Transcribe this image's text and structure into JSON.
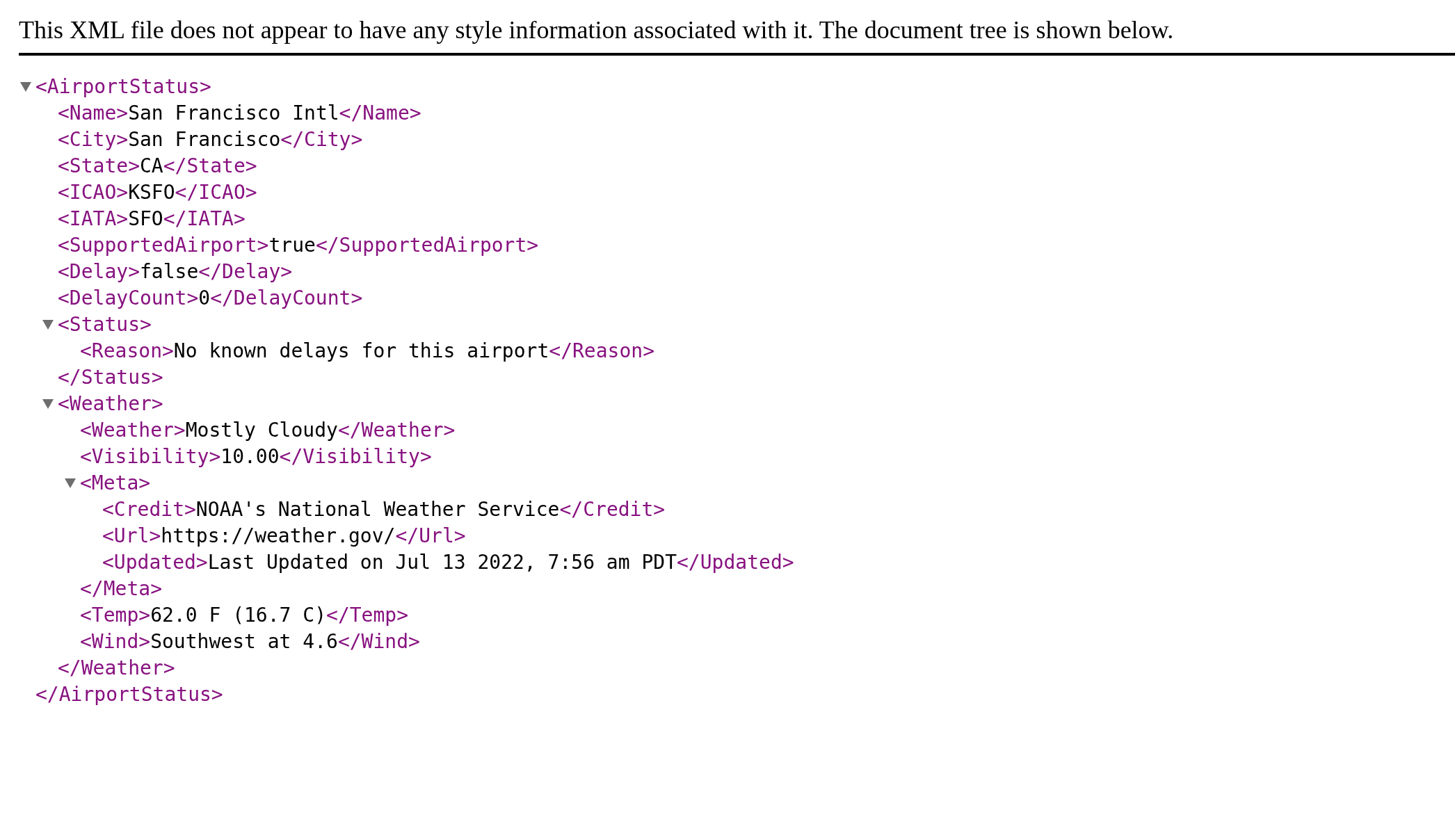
{
  "header": {
    "message": "This XML file does not appear to have any style information associated with it. The document tree is shown below."
  },
  "tree": {
    "open": "<AirportStatus>",
    "close": "</AirportStatus>",
    "expanded": true,
    "children": [
      {
        "open": "<Name>",
        "text": "San Francisco Intl",
        "close": "</Name>"
      },
      {
        "open": "<City>",
        "text": "San Francisco",
        "close": "</City>"
      },
      {
        "open": "<State>",
        "text": "CA",
        "close": "</State>"
      },
      {
        "open": "<ICAO>",
        "text": "KSFO",
        "close": "</ICAO>"
      },
      {
        "open": "<IATA>",
        "text": "SFO",
        "close": "</IATA>"
      },
      {
        "open": "<SupportedAirport>",
        "text": "true",
        "close": "</SupportedAirport>"
      },
      {
        "open": "<Delay>",
        "text": "false",
        "close": "</Delay>"
      },
      {
        "open": "<DelayCount>",
        "text": "0",
        "close": "</DelayCount>"
      },
      {
        "open": "<Status>",
        "close": "</Status>",
        "expanded": true,
        "children": [
          {
            "open": "<Reason>",
            "text": "No known delays for this airport",
            "close": "</Reason>"
          }
        ]
      },
      {
        "open": "<Weather>",
        "close": "</Weather>",
        "expanded": true,
        "children": [
          {
            "open": "<Weather>",
            "text": "Mostly Cloudy",
            "close": "</Weather>"
          },
          {
            "open": "<Visibility>",
            "text": "10.00",
            "close": "</Visibility>"
          },
          {
            "open": "<Meta>",
            "close": "</Meta>",
            "expanded": true,
            "children": [
              {
                "open": "<Credit>",
                "text": "NOAA's National Weather Service",
                "close": "</Credit>"
              },
              {
                "open": "<Url>",
                "text": "https://weather.gov/",
                "close": "</Url>"
              },
              {
                "open": "<Updated>",
                "text": "Last Updated on Jul 13 2022, 7:56 am PDT",
                "close": "</Updated>"
              }
            ]
          },
          {
            "open": "<Temp>",
            "text": "62.0 F (16.7 C)",
            "close": "</Temp>"
          },
          {
            "open": "<Wind>",
            "text": "Southwest at 4.6",
            "close": "</Wind>"
          }
        ]
      }
    ]
  }
}
